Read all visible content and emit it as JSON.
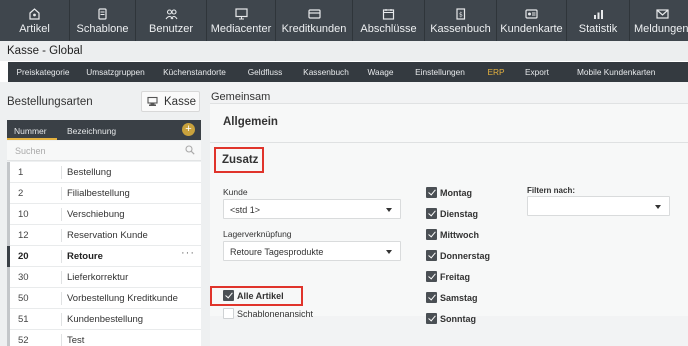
{
  "topnav": [
    {
      "label": "Artikel",
      "icon": "articles-icon"
    },
    {
      "label": "Schablone",
      "icon": "template-icon"
    },
    {
      "label": "Benutzer",
      "icon": "users-icon"
    },
    {
      "label": "Mediacenter",
      "icon": "monitor-icon"
    },
    {
      "label": "Kreditkunden",
      "icon": "credit-card-icon"
    },
    {
      "label": "Abschlüsse",
      "icon": "closing-icon"
    },
    {
      "label": "Kassenbuch",
      "icon": "cashbook-icon"
    },
    {
      "label": "Kundenkarte",
      "icon": "customer-card-icon"
    },
    {
      "label": "Statistik",
      "icon": "statistics-icon"
    },
    {
      "label": "Meldungen",
      "icon": "mail-icon"
    }
  ],
  "page_title": "Kasse - Global",
  "subnav": [
    {
      "label": "Preiskategorie",
      "active": false
    },
    {
      "label": "Umsatzgruppen",
      "active": false
    },
    {
      "label": "Küchenstandorte",
      "active": false
    },
    {
      "label": "Geldfluss",
      "active": false
    },
    {
      "label": "Kassenbuch",
      "active": false
    },
    {
      "label": "Waage",
      "active": false
    },
    {
      "label": "Einstellungen",
      "active": false
    },
    {
      "label": "ERP",
      "active": true
    },
    {
      "label": "Export",
      "active": false
    },
    {
      "label": "Mobile Kundenkarten",
      "active": false
    }
  ],
  "left": {
    "heading": "Bestellungsarten",
    "kasse_button": "Kasse",
    "col_nummer": "Nummer",
    "col_bezeichnung": "Bezeichnung",
    "add_icon": "+",
    "search_placeholder": "Suchen",
    "rows": [
      {
        "nr": "1",
        "name": "Bestellung"
      },
      {
        "nr": "2",
        "name": "Filialbestellung"
      },
      {
        "nr": "10",
        "name": "Verschiebung"
      },
      {
        "nr": "12",
        "name": "Reservation Kunde"
      },
      {
        "nr": "20",
        "name": "Retoure",
        "active": true,
        "menu": "···"
      },
      {
        "nr": "30",
        "name": "Lieferkorrektur"
      },
      {
        "nr": "50",
        "name": "Vorbestellung Kreditkunde"
      },
      {
        "nr": "51",
        "name": "Kundenbestellung"
      },
      {
        "nr": "52",
        "name": "Test"
      }
    ]
  },
  "right": {
    "heading": "Gemeinsam",
    "allgemein": "Allgemein",
    "zusatz": "Zusatz",
    "kunde_label": "Kunde",
    "kunde_value": "<std 1>",
    "lager_label": "Lagerverknüpfung",
    "lager_value": "Retoure Tagesprodukte",
    "alle_artikel": "Alle Artikel",
    "schablonen": "Schablonenansicht",
    "filter_label": "Filtern nach:",
    "filter_value": "",
    "days": [
      "Montag",
      "Dienstag",
      "Mittwoch",
      "Donnerstag",
      "Freitag",
      "Samstag",
      "Sonntag"
    ]
  },
  "colors": {
    "topbar": "#3f464d",
    "subnav": "#343a40",
    "accent": "#e5b23f",
    "highlight": "#e0342b"
  }
}
